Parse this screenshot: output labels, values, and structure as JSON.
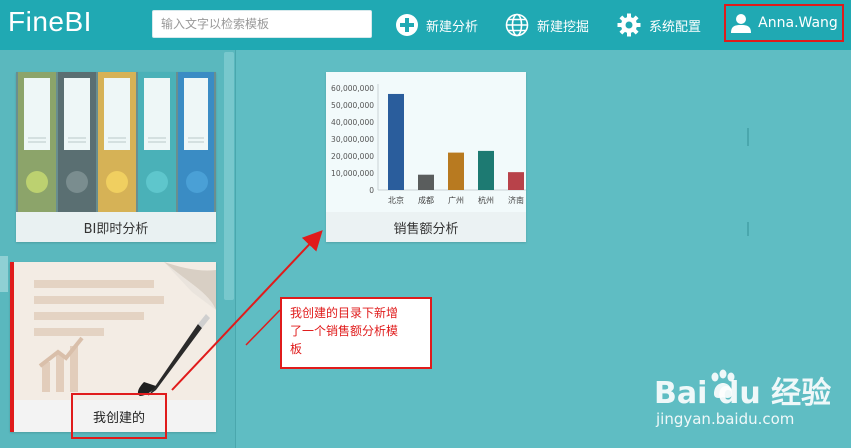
{
  "header": {
    "logo": "FineBI",
    "search_placeholder": "输入文字以检索模板",
    "new_analysis": "新建分析",
    "new_mining": "新建挖掘",
    "system_config": "系统配置",
    "user": "Anna.Wang"
  },
  "cards": {
    "instant": "BI即时分析",
    "mine": "我创建的",
    "sales": "销售额分析"
  },
  "annotation": {
    "line1": "我创建的目录下新增",
    "line2": "了一个销售额分析模",
    "line3": "板"
  },
  "watermark": {
    "brand": "Bai du 经验",
    "url": "jingyan.baidu.com"
  },
  "chart_data": {
    "type": "bar",
    "categories": [
      "北京",
      "成都",
      "广州",
      "杭州",
      "济南"
    ],
    "values": [
      56500000,
      9000000,
      22000000,
      23000000,
      10500000
    ],
    "colors": [
      "#2a5d9c",
      "#5a5d5d",
      "#b87a20",
      "#1d7a72",
      "#b8424a"
    ],
    "ylim": [
      0,
      60000000
    ],
    "yticks": [
      "0",
      "10,000,000",
      "20,000,000",
      "30,000,000",
      "40,000,000",
      "50,000,000",
      "60,000,000"
    ],
    "ytick_values": [
      0,
      10000000,
      20000000,
      30000000,
      40000000,
      50000000,
      60000000
    ]
  }
}
